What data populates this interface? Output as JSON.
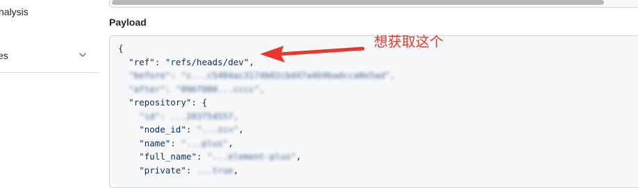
{
  "sidebar": {
    "items": [
      {
        "label": "nalysis"
      },
      {
        "label": "es"
      }
    ]
  },
  "payload": {
    "title": "Payload",
    "lines": [
      {
        "text": "{"
      },
      {
        "key": "\"ref\"",
        "value": "\"refs/heads/dev\""
      },
      {
        "key": "\"before\"",
        "value": "\"c...c5404ac3174b02cbd47a4b9badcca0e5ad\""
      },
      {
        "key": "\"after\"",
        "value": "\"896f080...cccc\""
      },
      {
        "key": "\"repository\"",
        "value": "{"
      },
      {
        "key": "\"id\"",
        "value": "...203754557"
      },
      {
        "key": "\"node_id\"",
        "value": "\"...zc=\""
      },
      {
        "key": "\"name\"",
        "value": "\"...plus\""
      },
      {
        "key": "\"full_name\"",
        "value": "\"...element-plus\""
      },
      {
        "key": "\"private\"",
        "value": "...true"
      }
    ]
  },
  "annotation": {
    "text": "想获取这个",
    "color": "#e8372c"
  }
}
